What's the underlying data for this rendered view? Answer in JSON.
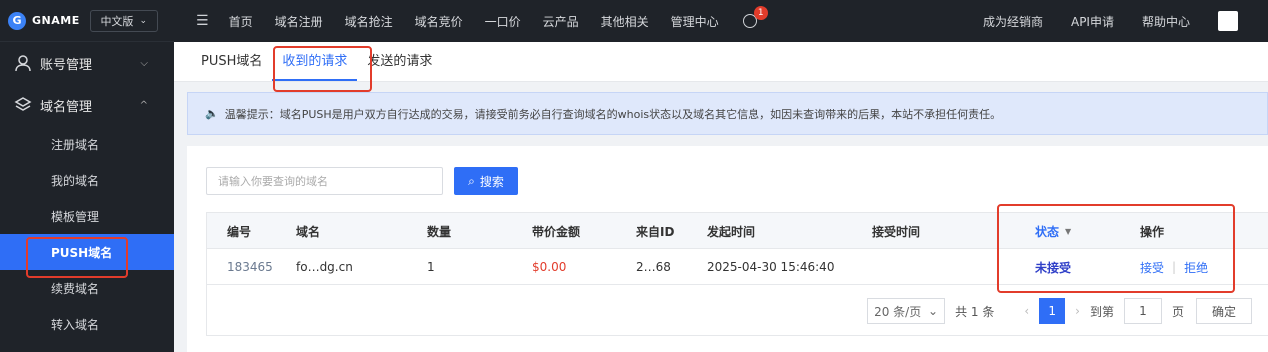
{
  "brand": {
    "name": "GNAME",
    "lang": "中文版"
  },
  "sidebar": {
    "groups": [
      {
        "label": "账号管理",
        "expanded": false
      },
      {
        "label": "域名管理",
        "expanded": true
      }
    ],
    "items": [
      "注册域名",
      "我的域名",
      "模板管理",
      "PUSH域名",
      "续费域名",
      "转入域名"
    ]
  },
  "topbar": {
    "nav": [
      "首页",
      "域名注册",
      "域名抢注",
      "域名竞价",
      "一口价",
      "云产品",
      "其他相关",
      "管理中心"
    ],
    "notification_count": "1",
    "right": [
      "成为经销商",
      "API申请",
      "帮助中心"
    ]
  },
  "tabs": [
    "PUSH域名",
    "收到的请求",
    "发送的请求"
  ],
  "notice": "温馨提示：域名PUSH是用户双方自行达成的交易，请接受前务必自行查询域名的whois状态以及域名其它信息，如因未查询带来的后果，本站不承担任何责任。",
  "search": {
    "placeholder": "请输入你要查询的域名",
    "button": "搜索"
  },
  "table": {
    "headers": [
      "编号",
      "域名",
      "数量",
      "带价金额",
      "来自ID",
      "发起时间",
      "接受时间",
      "状态",
      "操作"
    ],
    "rows": [
      {
        "id": "183465",
        "domain": "fo…dg.cn",
        "qty": "1",
        "price": "$0.00",
        "from_id": "2…68",
        "start": "2025-04-30 15:46:40",
        "accept": "",
        "status": "未接受",
        "accept_btn": "接受",
        "reject_btn": "拒绝"
      }
    ]
  },
  "pager": {
    "page_size": "20 条/页",
    "total": "共 1 条",
    "current": "1",
    "goto_label": "到第",
    "goto_value": "1",
    "page_unit": "页",
    "confirm": "确定"
  },
  "colors": {
    "accent": "#2f6ef6",
    "highlight": "#e23c2b",
    "sidebar_bg": "#1f2329"
  }
}
